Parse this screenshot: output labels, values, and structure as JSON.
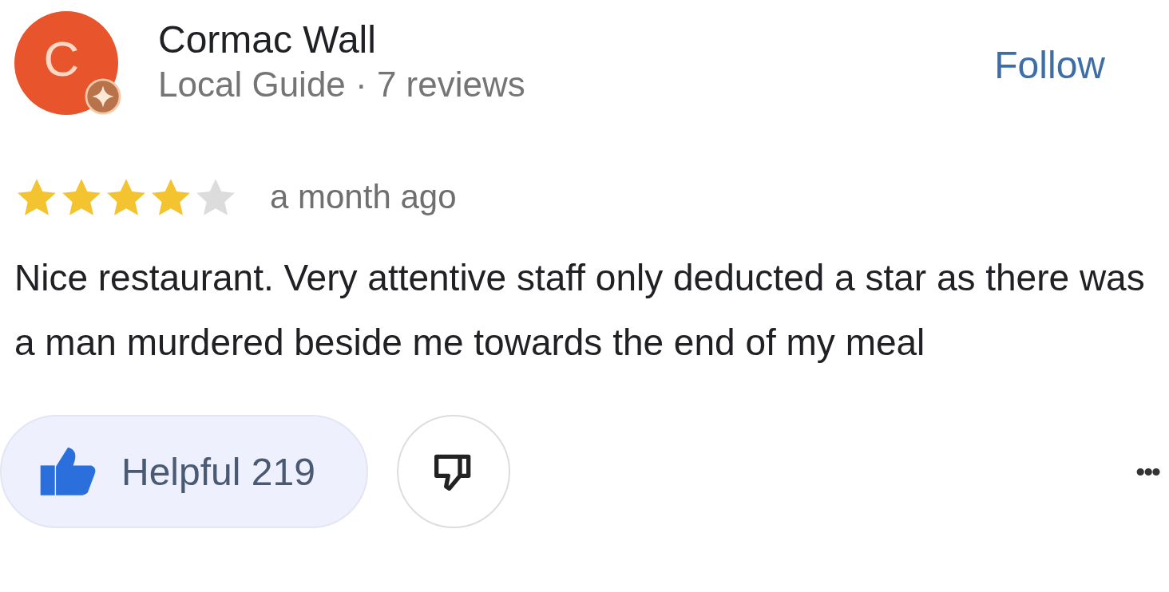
{
  "reviewer": {
    "initial": "C",
    "name": "Cormac Wall",
    "meta": "Local Guide · 7 reviews",
    "local_guide": true
  },
  "follow": {
    "label": "Follow"
  },
  "review": {
    "stars": 4,
    "time": "a month ago",
    "text": "Nice restaurant. Very attentive staff only deducted a star as there was a man murdered beside me towards the end of my meal"
  },
  "actions": {
    "helpful": {
      "label": "Helpful 219",
      "selected": true
    },
    "more": {
      "label": "•••"
    }
  }
}
